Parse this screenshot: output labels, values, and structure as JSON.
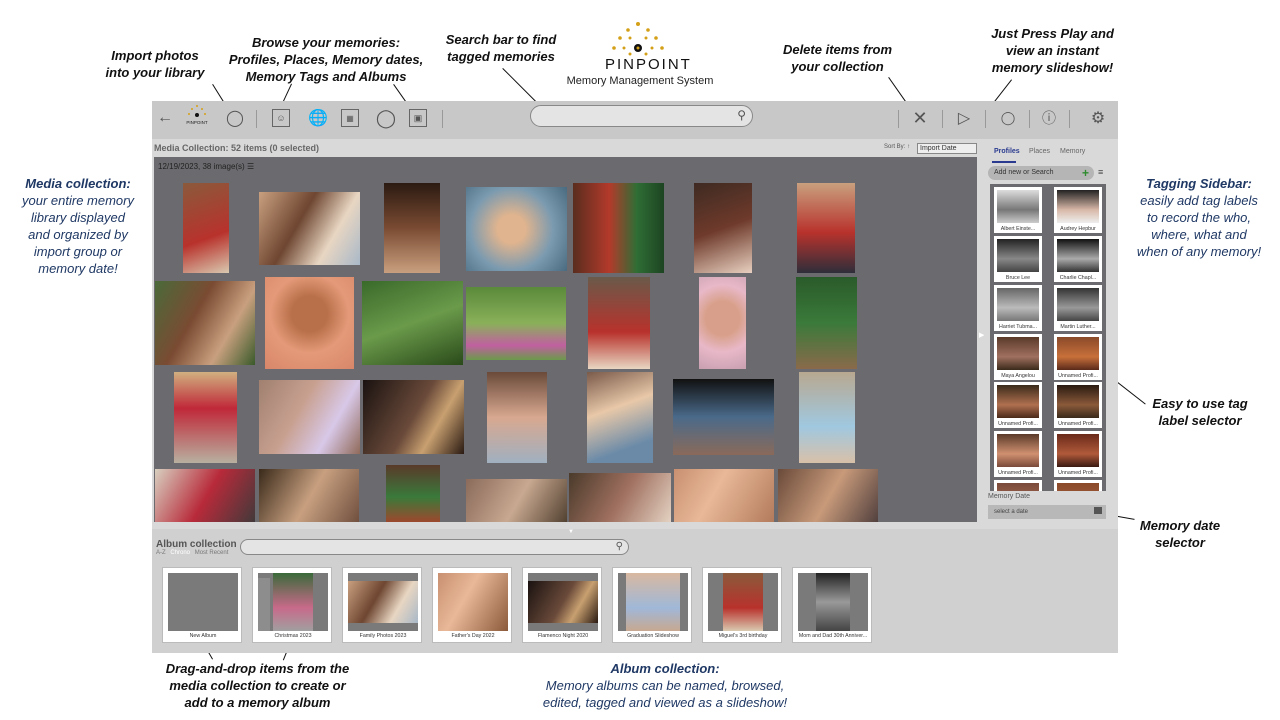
{
  "brand": {
    "name": "PINPOINT",
    "subtitle": "Memory Management System",
    "toolbar_logo_text": "PINPOINT"
  },
  "callouts": {
    "import": "Import photos\ninto your library",
    "browse": "Browse your memories:\nProfiles, Places, Memory dates,\nMemory Tags and Albums",
    "search": "Search bar to find\ntagged memories",
    "delete": "Delete items from\nyour collection",
    "play": "Just Press Play and\nview an instant\nmemory slideshow!",
    "media_title": "Media collection:",
    "media_body": "your entire memory\nlibrary displayed\nand organized by\nimport group or\nmemory date!",
    "tagging_title": "Tagging Sidebar:",
    "tagging_body": "easily add tag labels\nto record the who,\nwhere, what and\nwhen of any memory!",
    "tag_selector": "Easy to use tag\nlabel selector",
    "date_selector": "Memory date\nselector",
    "drag_drop": "Drag-and-drop items from the\nmedia collection to create or\nadd to a memory album",
    "album_title": "Album collection:",
    "album_body": "Memory albums can be named, browsed,\nedited, tagged and viewed as a slideshow!"
  },
  "toolbar": {
    "back_icon": "arrow-left",
    "icons": [
      "import-icon",
      "profiles-icon",
      "globe-icon",
      "calendar-icon",
      "tag-icon",
      "album-icon"
    ],
    "search_placeholder": "",
    "right_icons": [
      "delete-icon",
      "play-icon",
      "comment-icon",
      "help-icon",
      "settings-icon"
    ]
  },
  "media": {
    "header": "Media Collection: 52 items (0 selected)",
    "sort_label": "Sort By: ↑",
    "sort_value": "Import Date",
    "group_header": "12/19/2023, 38 image(s) ☰"
  },
  "sidebar": {
    "tabs": [
      {
        "label": "Profiles",
        "active": true
      },
      {
        "label": "Places",
        "active": false
      },
      {
        "label": "Memory",
        "active": false
      }
    ],
    "search_placeholder": "Add new or Search",
    "profiles": [
      "Albert Einste...",
      "Audrey Hepbur",
      "Bruce Lee",
      "Charlie Chapl...",
      "Harriet Tubma...",
      "Martin Luther...",
      "Maya Angelou",
      "Unnamed Profi...",
      "Unnamed Profi...",
      "Unnamed Profi...",
      "Unnamed Profi...",
      "Unnamed Profi..."
    ],
    "memory_date_label": "Memory Date",
    "memory_date_placeholder": "select a date"
  },
  "albums": {
    "title": "Album collection",
    "sort_options": [
      {
        "label": "A-Z",
        "active": false
      },
      {
        "label": "Chrono",
        "active": true
      },
      {
        "label": "Most Recent",
        "active": false
      }
    ],
    "items": [
      "New Album",
      "Christmas 2023",
      "Family Photos 2023",
      "Father's Day 2022",
      "Flamenco Night 2020",
      "Graduation Slideshow",
      "Miguel's 3rd birthday",
      "Mom and Dad 30th Anniver..."
    ]
  },
  "colors": {
    "grid_bg": "#6b6b6f",
    "app_bg": "#d9d9d9",
    "toolbar_bg": "#c8c8c8",
    "accent": "#2a3b8f",
    "callout_navy": "#1f3864",
    "logo_gold": "#d4a017"
  }
}
